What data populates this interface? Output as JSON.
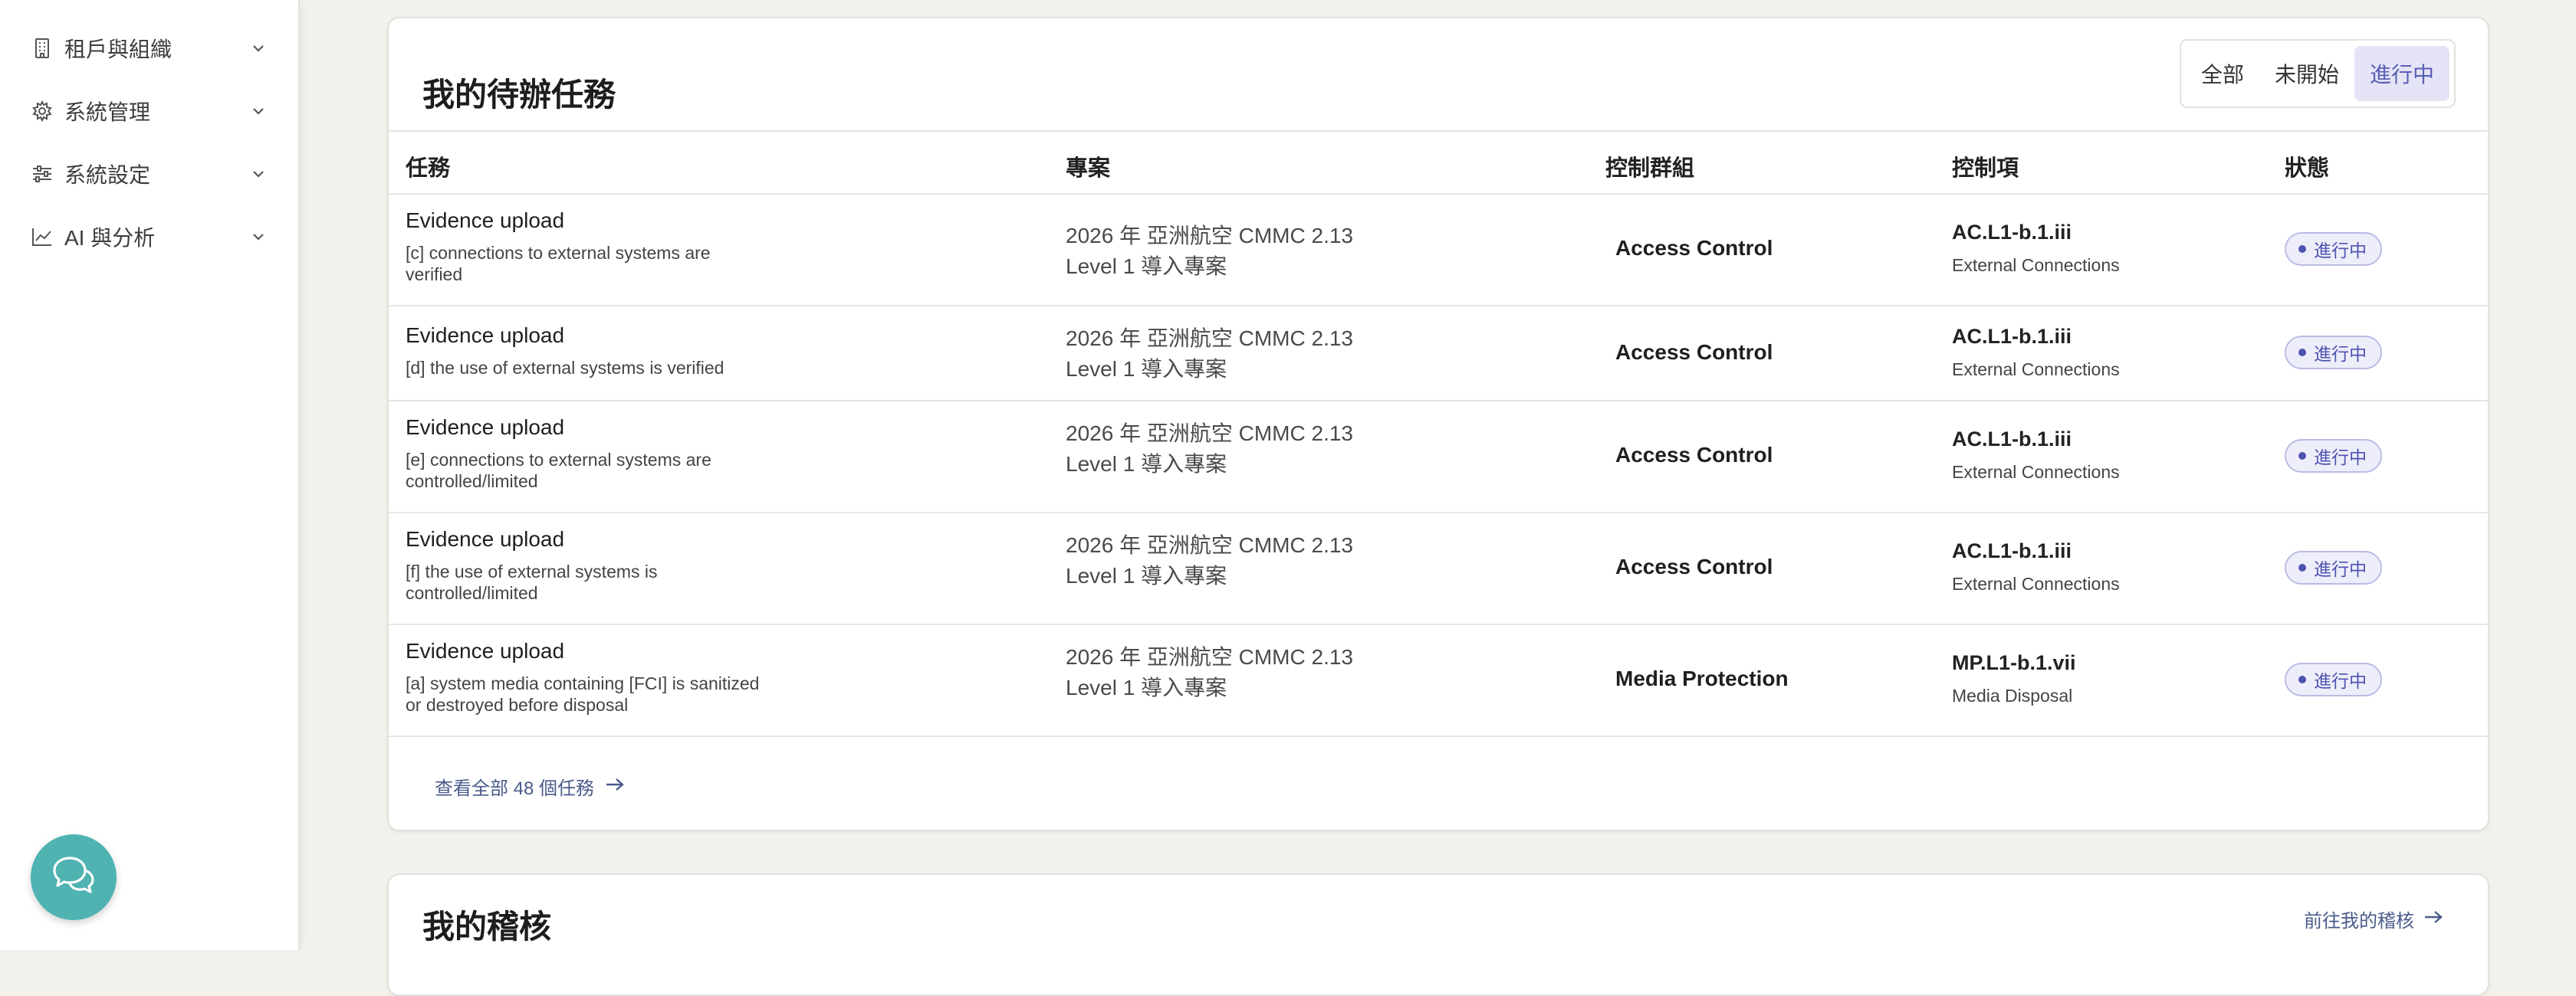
{
  "sidebar": {
    "items": [
      {
        "label": "租戶與組織",
        "icon": "building-icon"
      },
      {
        "label": "系統管理",
        "icon": "gear-icon"
      },
      {
        "label": "系統設定",
        "icon": "sliders-icon"
      },
      {
        "label": "AI 與分析",
        "icon": "chart-line-icon"
      }
    ],
    "chat_icon": "chat-bubbles-icon"
  },
  "tasks_card": {
    "title": "我的待辦任務",
    "filters": [
      {
        "label": "全部",
        "active": false
      },
      {
        "label": "未開始",
        "active": false
      },
      {
        "label": "進行中",
        "active": true
      }
    ],
    "columns": [
      "任務",
      "專案",
      "控制群組",
      "控制項",
      "狀態"
    ],
    "rows": [
      {
        "task": "Evidence upload",
        "desc_line1": "[c] connections to external systems are",
        "desc_line2": "verified",
        "project_line1": "2026 年 亞洲航空 CMMC 2.13",
        "project_line2": "Level 1 導入專案",
        "group": "Access Control",
        "control_code": "AC.L1-b.1.iii",
        "control_name": "External Connections",
        "status": "進行中"
      },
      {
        "task": "Evidence upload",
        "desc_line1": "[d] the use of external systems is verified",
        "desc_line2": "",
        "project_line1": "2026 年 亞洲航空 CMMC 2.13",
        "project_line2": "Level 1 導入專案",
        "group": "Access Control",
        "control_code": "AC.L1-b.1.iii",
        "control_name": "External Connections",
        "status": "進行中"
      },
      {
        "task": "Evidence upload",
        "desc_line1": "[e] connections to external systems are",
        "desc_line2": "controlled/limited",
        "project_line1": "2026 年 亞洲航空 CMMC 2.13",
        "project_line2": "Level 1 導入專案",
        "group": "Access Control",
        "control_code": "AC.L1-b.1.iii",
        "control_name": "External Connections",
        "status": "進行中"
      },
      {
        "task": "Evidence upload",
        "desc_line1": "[f] the use of external systems is",
        "desc_line2": "controlled/limited",
        "project_line1": "2026 年 亞洲航空 CMMC 2.13",
        "project_line2": "Level 1 導入專案",
        "group": "Access Control",
        "control_code": "AC.L1-b.1.iii",
        "control_name": "External Connections",
        "status": "進行中"
      },
      {
        "task": "Evidence upload",
        "desc_line1": "[a] system media containing [FCI] is sanitized",
        "desc_line2": "or destroyed before disposal",
        "project_line1": "2026 年 亞洲航空 CMMC 2.13",
        "project_line2": "Level 1 導入專案",
        "group": "Media Protection",
        "control_code": "MP.L1-b.1.vii",
        "control_name": "Media Disposal",
        "status": "進行中"
      }
    ],
    "view_all": "查看全部 48 個任務"
  },
  "audits_card": {
    "title": "我的稽核",
    "link": "前往我的稽核"
  },
  "colors": {
    "accent": "#5a5fb5",
    "chat_fab": "#4fb3b1",
    "link": "#4a5b8a"
  }
}
